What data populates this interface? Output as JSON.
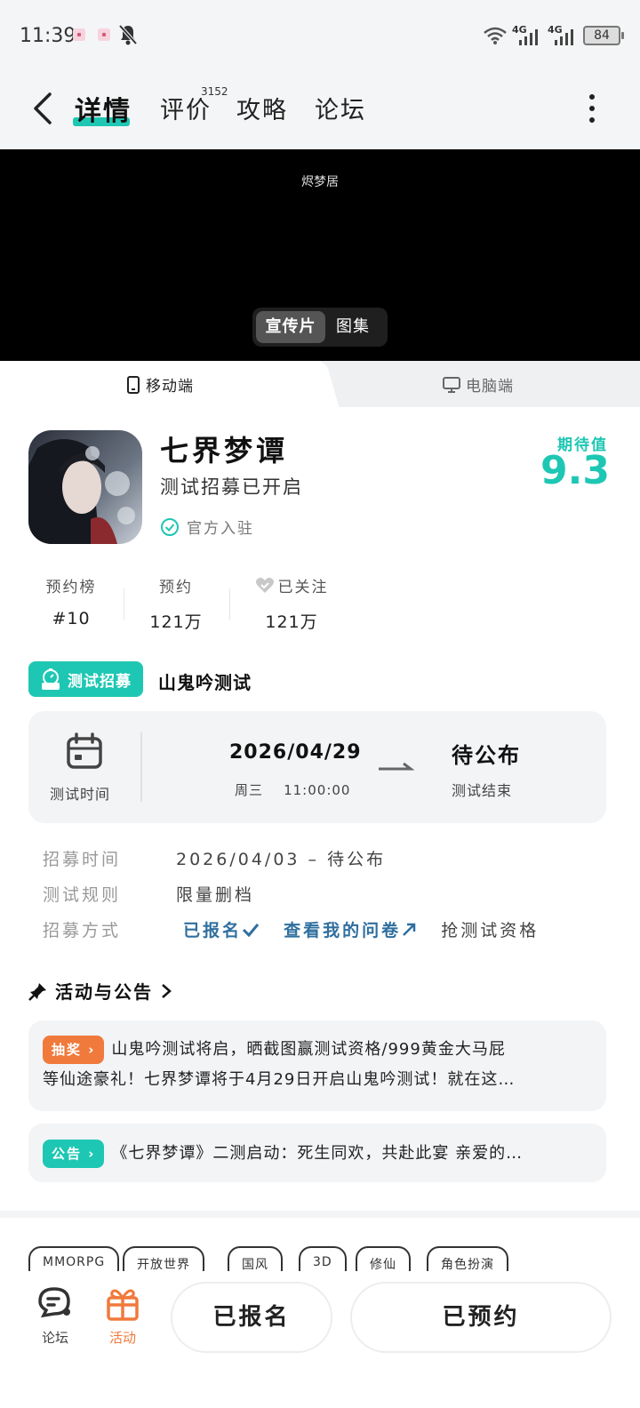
{
  "status_bar": {
    "time": "11:39",
    "net1": "4G",
    "net2": "4G",
    "battery": "84"
  },
  "nav": {
    "tabs": [
      {
        "label": "详情"
      },
      {
        "label": "评价",
        "badge": "3152"
      },
      {
        "label": "攻略"
      },
      {
        "label": "论坛"
      }
    ]
  },
  "media": {
    "watermark": "烬梦居",
    "segments": [
      "宣传片",
      "图集"
    ]
  },
  "platform": {
    "mobile": "移动端",
    "pc": "电脑端"
  },
  "game": {
    "title": "七界梦谭",
    "subtitle": "测试招募已开启",
    "official": "官方入驻",
    "expect_label": "期待值",
    "expect_score": "9.3"
  },
  "stats": [
    {
      "label": "预约榜",
      "value": "#10"
    },
    {
      "label": "预约",
      "value": "121万"
    },
    {
      "label": "已关注",
      "value": "121万"
    }
  ],
  "test": {
    "badge": "测试招募",
    "name": "山鬼吟测试",
    "time_label": "测试时间",
    "start_date": "2026/04/29",
    "start_weekday": "周三",
    "start_time": "11:00:00",
    "end_value": "待公布",
    "end_label": "测试结束"
  },
  "info": {
    "recruit_time_label": "招募时间",
    "recruit_time_value": "2026/04/03 – 待公布",
    "rules_label": "测试规则",
    "rules_value": "限量删档",
    "method_label": "招募方式",
    "registered": "已报名",
    "my_survey": "查看我的问卷",
    "grab": "抢测试资格"
  },
  "activities": {
    "title": "活动与公告",
    "items": [
      {
        "tag": "抽奖",
        "tag_color": "#f07a3c",
        "line1": "山鬼吟测试将启，晒截图赢测试资格/999黄金大马屁",
        "line2": "等仙途豪礼！七界梦谭将于4月29日开启山鬼吟测试！就在这…"
      },
      {
        "tag": "公告",
        "tag_color": "#1ec7b3",
        "line1": "《七界梦谭》二测启动：死生同欢，共赴此宴 亲爱的…"
      }
    ]
  },
  "tags": [
    "MMORPG",
    "开放世界",
    "国风",
    "3D",
    "修仙",
    "角色扮演"
  ],
  "bottom": {
    "forum": "论坛",
    "activity": "活动",
    "registered_btn": "已报名",
    "reserved_btn": "已预约"
  },
  "colors": {
    "accent": "#1ec7b3",
    "orange": "#f07a3c",
    "link": "#2f6f9f"
  }
}
